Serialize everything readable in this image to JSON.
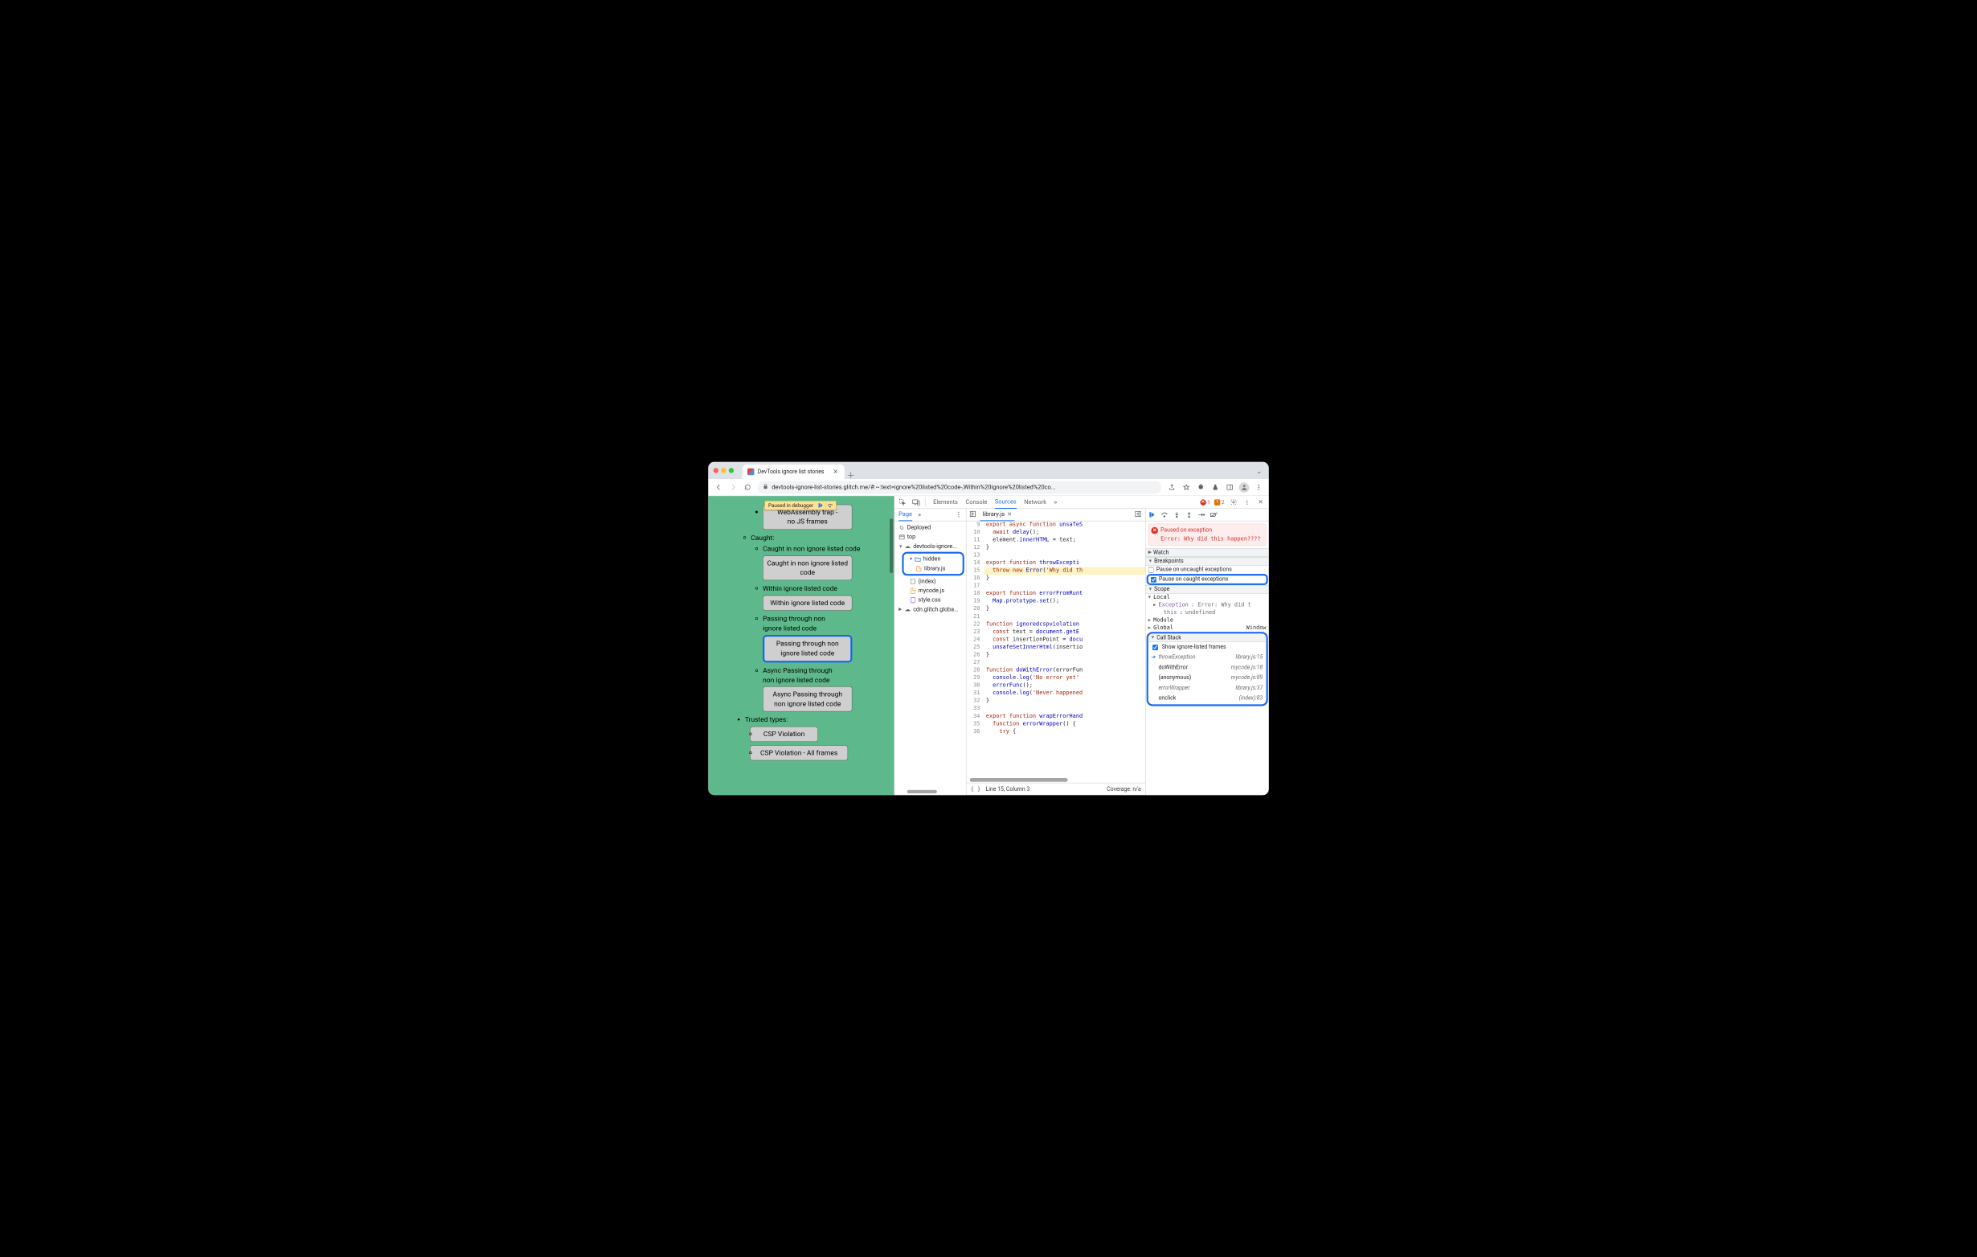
{
  "window": {
    "tab_title": "DevTools ignore list stories",
    "url": "devtools-ignore-list-stories.glitch.me/#:~:text=ignore%20listed%20code-,Within%20ignore%20listed%20co..."
  },
  "paused_pill": "Paused in debugger",
  "page": {
    "top_btn_line1": "WebAssembly trap -",
    "top_btn_line2": "no JS frames",
    "caught": "Caught:",
    "li1": "Caught in non ignore listed code",
    "btn1": "Caught in non ignore listed code",
    "li2": "Within ignore listed code",
    "btn2": "Within ignore listed code",
    "li3a": "Passing through non",
    "li3b": "ignore listed code",
    "btn3": "Passing through non ignore listed code",
    "li4a": "Async Passing through",
    "li4b": "non ignore listed code",
    "btn4": "Async Passing through non ignore listed code",
    "trusted": "Trusted types:",
    "cspt1": "CSP Violation",
    "cspt2": "CSP Violation - All frames"
  },
  "dt_tabs": {
    "elements": "Elements",
    "console": "Console",
    "sources": "Sources",
    "network": "Network"
  },
  "dt_badge": {
    "err": "1",
    "warn": "2"
  },
  "nav": {
    "page": "Page",
    "deployed": "Deployed",
    "top": "top",
    "host": "devtools-ignore...",
    "hidden": "hidden",
    "libjs": "library.js",
    "index": "(index)",
    "mycode": "mycode.js",
    "style": "style.css",
    "cdn": "cdn.glitch.globa..."
  },
  "ed": {
    "file": "library.js",
    "lines": {
      "9": [
        "export ",
        "async ",
        "function ",
        "unsafeS"
      ],
      "10": [
        "  ",
        "await ",
        "delay",
        "();"
      ],
      "11": [
        "  element.",
        "innerHTML",
        " = text;"
      ],
      "12": [
        "}"
      ],
      "13": [
        ""
      ],
      "14": [
        "export ",
        "function ",
        "throwExcepti"
      ],
      "15": [
        "  ",
        "throw ",
        "new ",
        "Error",
        "(",
        "'Why did th"
      ],
      "16": [
        "}"
      ],
      "17": [
        ""
      ],
      "18": [
        "export ",
        "function ",
        "errorFromRunt"
      ],
      "19": [
        "  ",
        "Map",
        ".",
        "prototype",
        ".",
        "set",
        "();"
      ],
      "20": [
        "}"
      ],
      "21": [
        ""
      ],
      "22": [
        "function ",
        "ignoredcspviolation"
      ],
      "23": [
        "  ",
        "const ",
        "text = ",
        "document",
        ".",
        "getE"
      ],
      "24": [
        "  ",
        "const ",
        "insertionPoint = ",
        "docu"
      ],
      "25": [
        "  ",
        "unsafeSetInnerHtml",
        "(insertio"
      ],
      "26": [
        "}"
      ],
      "27": [
        ""
      ],
      "28": [
        "function ",
        "doWithError",
        "(errorFun"
      ],
      "29": [
        "  ",
        "console",
        ".",
        "log",
        "(",
        "'No error yet'"
      ],
      "30": [
        "  ",
        "errorFunc",
        "();"
      ],
      "31": [
        "  ",
        "console",
        ".",
        "log",
        "(",
        "'Never happened"
      ],
      "32": [
        "}"
      ],
      "33": [
        ""
      ],
      "34": [
        "export ",
        "function ",
        "wrapErrorHand"
      ],
      "35": [
        "  ",
        "function ",
        "errorWrapper",
        "() {"
      ],
      "36": [
        "    ",
        "try",
        " {"
      ]
    },
    "status_line": "Line 15, Column 3",
    "status_cov": "Coverage: n/a"
  },
  "dbg": {
    "msg_title": "Paused on exception",
    "msg_body": "Error: Why did this happen????",
    "watch": "Watch",
    "breakpoints": "Breakpoints",
    "uncaught": "Pause on uncaught exceptions",
    "caught": "Pause on caught exceptions",
    "scope": "Scope",
    "local": "Local",
    "excpt": "Exception",
    "excpt_v": ": Error: Why did t",
    "this": "this",
    "this_v": "undefined",
    "module": "Module",
    "global": "Global",
    "global_v": "Window",
    "callstack": "Call Stack",
    "showign": "Show ignore-listed frames",
    "frames": [
      {
        "name": "throwException",
        "loc": "library.js:15",
        "dim": true,
        "ptr": true
      },
      {
        "name": "doWithError",
        "loc": "mycode.js:18",
        "dim": false
      },
      {
        "name": "(anonymous)",
        "loc": "mycode.js:89",
        "dim": false
      },
      {
        "name": "errorWrapper",
        "loc": "library.js:37",
        "dim": true
      },
      {
        "name": "onclick",
        "loc": "(index):83",
        "dim": false
      }
    ]
  }
}
